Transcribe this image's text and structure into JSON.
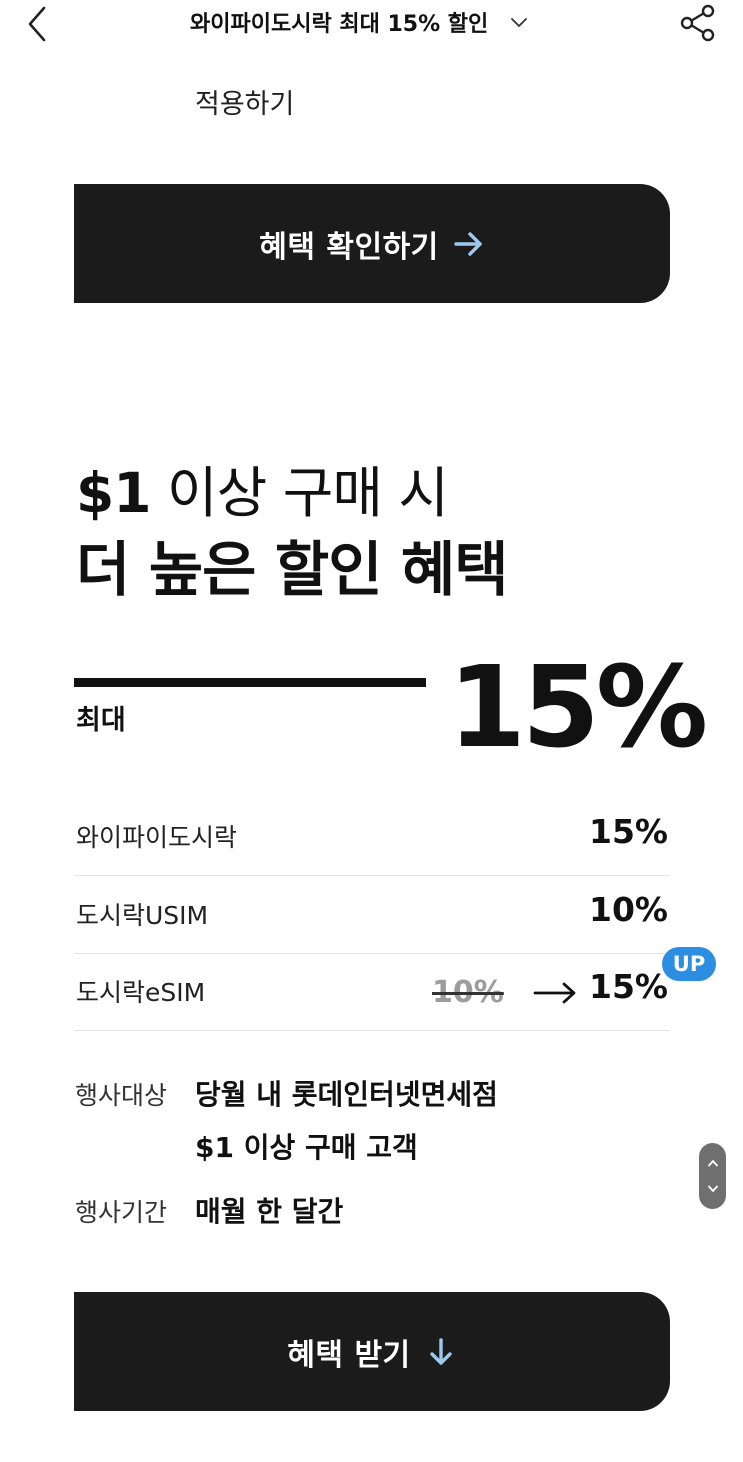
{
  "header": {
    "title": "와이파이도시락 최대 15% 할인",
    "back_icon": "chevron-left-icon",
    "title_dropdown_icon": "chevron-down-icon",
    "share_icon": "share-icon"
  },
  "intro": {
    "apply_text": "적용하기"
  },
  "check_button": {
    "label": "혜택 확인하기",
    "icon": "arrow-right-icon",
    "icon_color": "#9ec9ec"
  },
  "headline": {
    "line1_prefix": "$1",
    "line1_rest": " 이상 구매 시",
    "line2": "더 높은 할인 혜택"
  },
  "max_discount": {
    "label": "최대",
    "value": "15%"
  },
  "rates": [
    {
      "name": "와이파이도시락",
      "rate": "15%"
    },
    {
      "name": "도시락USIM",
      "rate": "10%"
    },
    {
      "name": "도시락eSIM",
      "old_rate": "10%",
      "rate": "15%",
      "badge": "UP"
    }
  ],
  "event_info": {
    "target_label": "행사대상",
    "target_line1": "당월 내 롯데인터넷면세점",
    "target_line2_prefix": "$1",
    "target_line2_rest": " 이상 구매 고객",
    "period_label": "행사기간",
    "period_value": "매월 한 달간"
  },
  "get_button": {
    "label": "혜택 받기",
    "icon": "arrow-down-icon",
    "icon_color": "#9ec9ec"
  },
  "scroll_control": {
    "up_icon": "chevron-up-icon",
    "down_icon": "chevron-down-icon"
  },
  "colors": {
    "dark_button": "#1b1b1b",
    "badge_blue": "#2c8ee0",
    "text": "#111111"
  }
}
